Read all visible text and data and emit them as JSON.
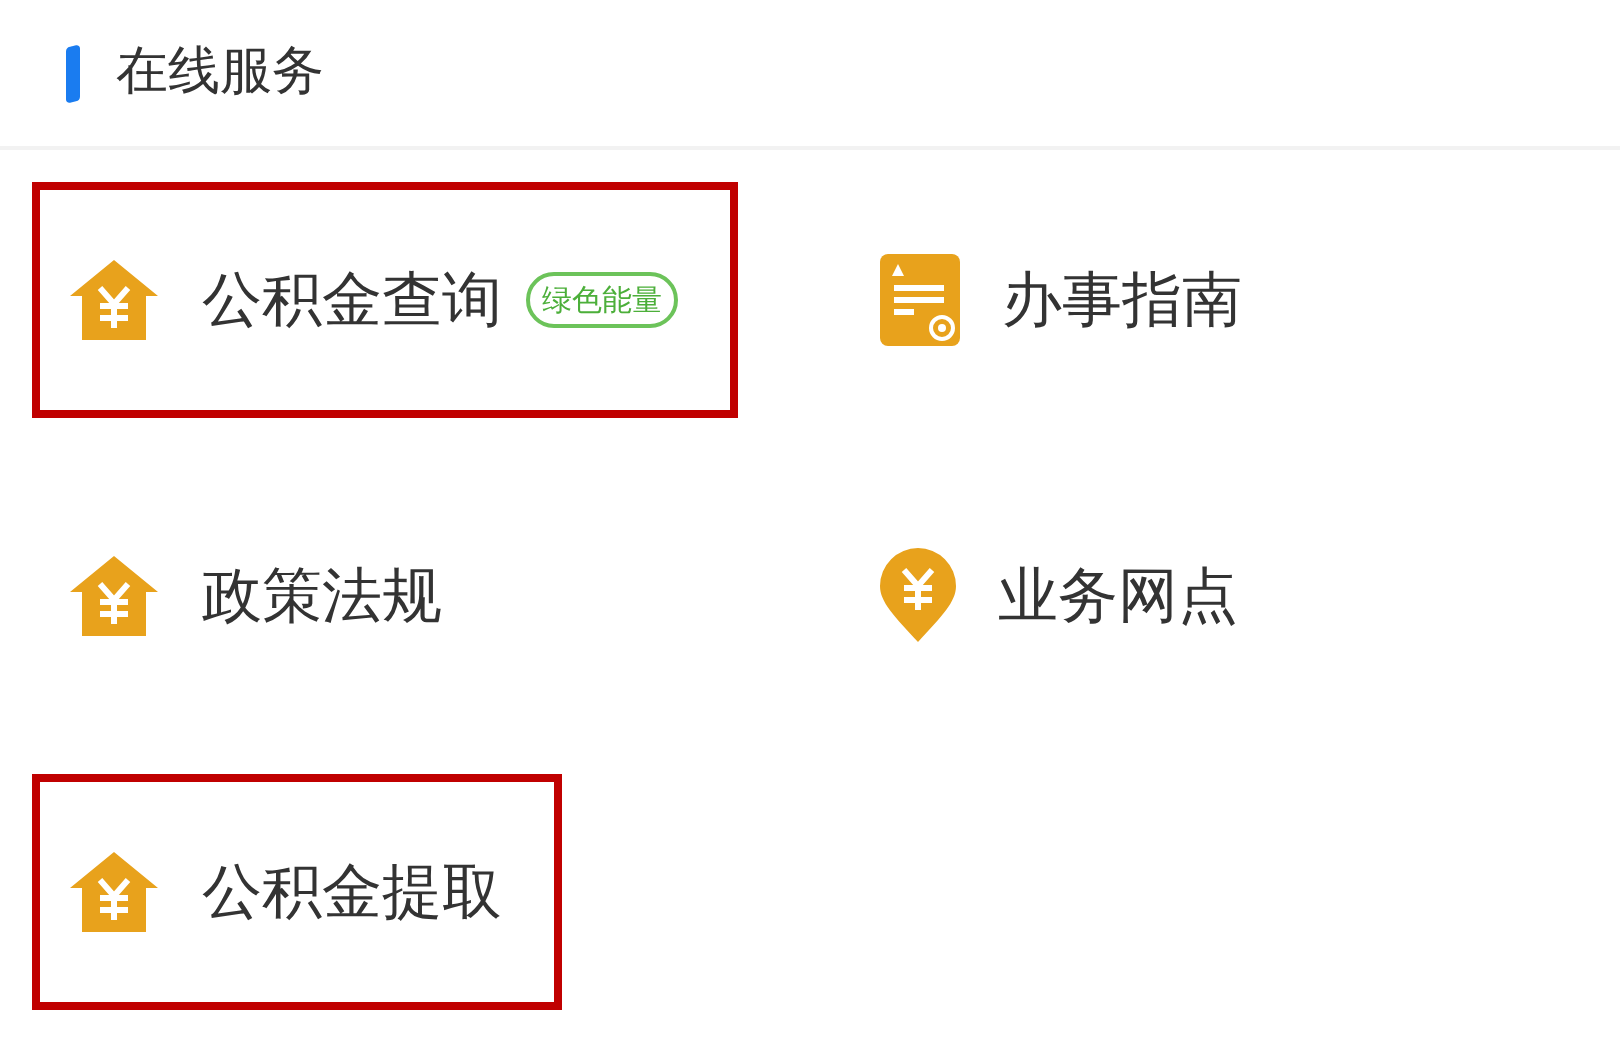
{
  "section": {
    "title": "在线服务"
  },
  "items": [
    {
      "kind": "house",
      "label": "公积金查询",
      "badge": "绿色能量",
      "highlighted": true
    },
    {
      "kind": "document",
      "label": "办事指南",
      "highlighted": false
    },
    {
      "kind": "house",
      "label": "政策法规",
      "highlighted": false
    },
    {
      "kind": "pin",
      "label": "业务网点",
      "highlighted": false
    },
    {
      "kind": "house",
      "label": "公积金提取",
      "highlighted": true
    }
  ]
}
